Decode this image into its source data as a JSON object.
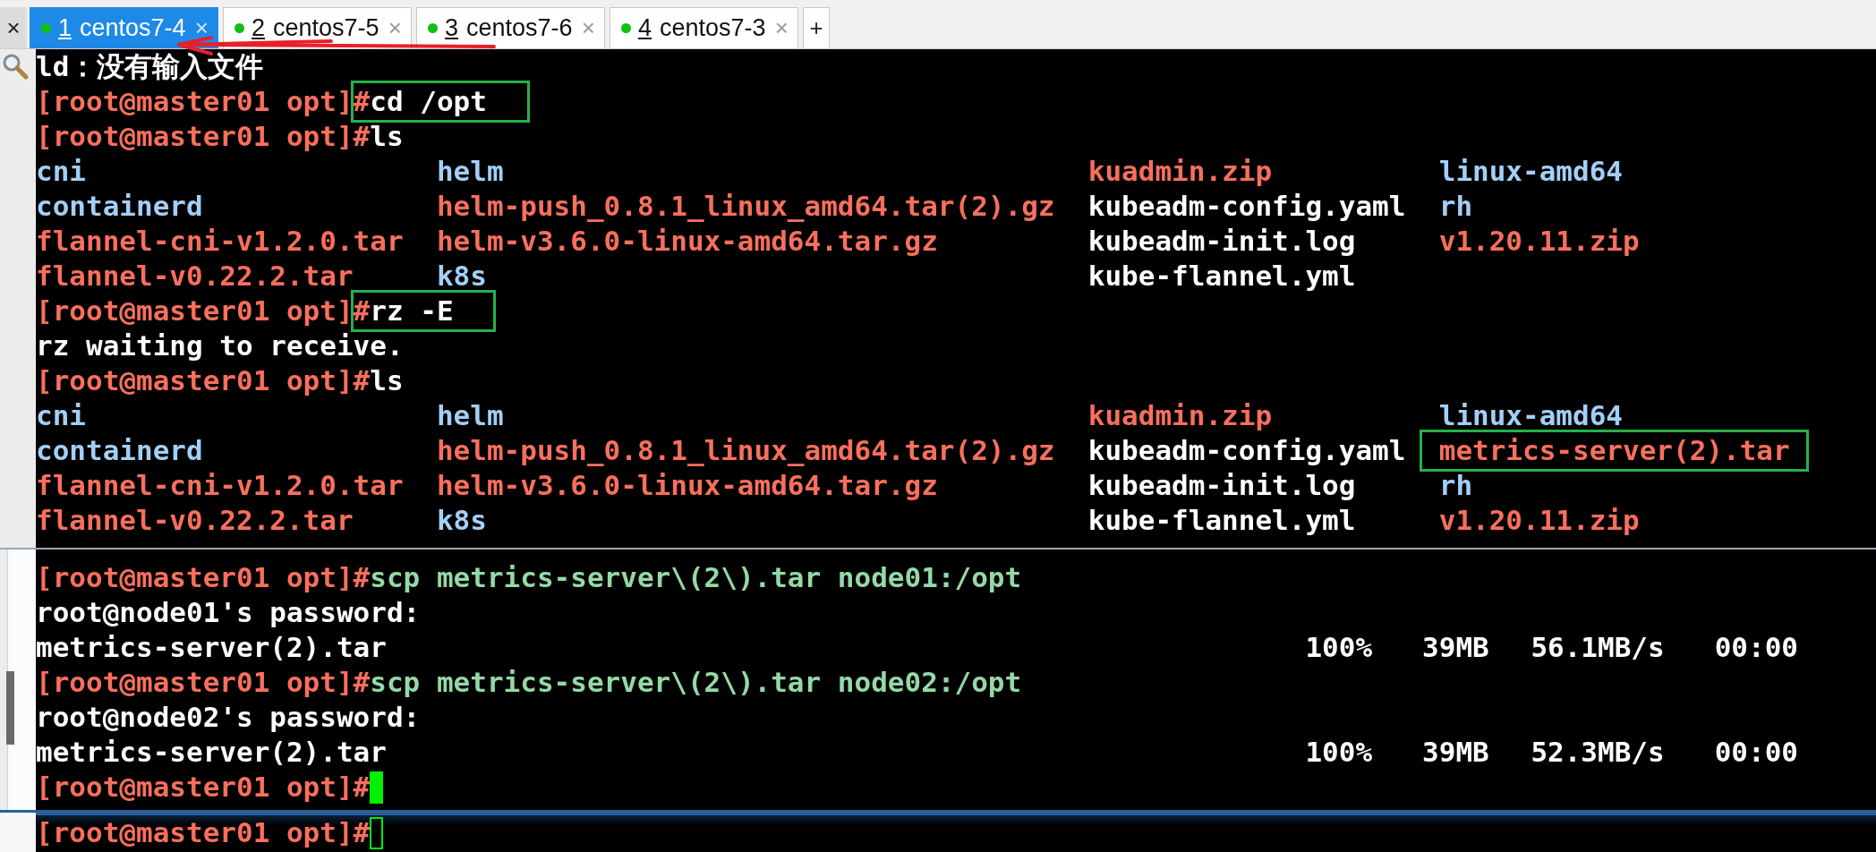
{
  "toolbar": {
    "close": "×"
  },
  "tabs": [
    {
      "number": "1",
      "label": "centos7-4",
      "close": "×",
      "selected": true
    },
    {
      "number": "2",
      "label": "centos7-5",
      "close": "×",
      "selected": false
    },
    {
      "number": "3",
      "label": "centos7-6",
      "close": "×",
      "selected": false
    },
    {
      "number": "4",
      "label": "centos7-3",
      "close": "×",
      "selected": false
    }
  ],
  "new_tab": "+",
  "panels": [
    {
      "kind": "main",
      "lines": [
        {
          "kind": "output",
          "text": "ld：没有输入文件"
        },
        {
          "kind": "prompt",
          "prompt": "[root@master01 opt]",
          "sign": "#",
          "command": "cd /opt",
          "highlighted": true
        },
        {
          "kind": "prompt",
          "prompt": "[root@master01 opt]",
          "sign": "#",
          "command": "ls",
          "highlighted": false
        },
        {
          "kind": "listing",
          "entries": [
            {
              "text": "cni",
              "kind": "dir",
              "highlighted": false
            },
            {
              "text": "helm",
              "kind": "dir",
              "highlighted": false
            },
            {
              "text": "kuadmin.zip",
              "kind": "archive",
              "highlighted": false
            },
            {
              "text": "linux-amd64",
              "kind": "dir",
              "highlighted": false
            }
          ]
        },
        {
          "kind": "listing",
          "entries": [
            {
              "text": "containerd",
              "kind": "dir",
              "highlighted": false
            },
            {
              "text": "helm-push_0.8.1_linux_amd64.tar(2).gz",
              "kind": "archive",
              "highlighted": false
            },
            {
              "text": "kubeadm-config.yaml",
              "kind": "file",
              "highlighted": false
            },
            {
              "text": "rh",
              "kind": "dir",
              "highlighted": false
            }
          ]
        },
        {
          "kind": "listing",
          "entries": [
            {
              "text": "flannel-cni-v1.2.0.tar",
              "kind": "archive",
              "highlighted": false
            },
            {
              "text": "helm-v3.6.0-linux-amd64.tar.gz",
              "kind": "archive",
              "highlighted": false
            },
            {
              "text": "kubeadm-init.log",
              "kind": "file",
              "highlighted": false
            },
            {
              "text": "v1.20.11.zip",
              "kind": "archive",
              "highlighted": false
            }
          ]
        },
        {
          "kind": "listing",
          "entries": [
            {
              "text": "flannel-v0.22.2.tar",
              "kind": "archive",
              "highlighted": false
            },
            {
              "text": "k8s",
              "kind": "dir",
              "highlighted": false
            },
            {
              "text": "kube-flannel.yml",
              "kind": "file",
              "highlighted": false
            }
          ]
        },
        {
          "kind": "prompt",
          "prompt": "[root@master01 opt]",
          "sign": "#",
          "command": "rz -E",
          "highlighted": true
        },
        {
          "kind": "output",
          "text": "rz waiting to receive."
        },
        {
          "kind": "prompt",
          "prompt": "[root@master01 opt]",
          "sign": "#",
          "command": "ls",
          "highlighted": false
        },
        {
          "kind": "listing",
          "entries": [
            {
              "text": "cni",
              "kind": "dir",
              "highlighted": false
            },
            {
              "text": "helm",
              "kind": "dir",
              "highlighted": false
            },
            {
              "text": "kuadmin.zip",
              "kind": "archive",
              "highlighted": false
            },
            {
              "text": "linux-amd64",
              "kind": "dir",
              "highlighted": false
            }
          ]
        },
        {
          "kind": "listing",
          "entries": [
            {
              "text": "containerd",
              "kind": "dir",
              "highlighted": false
            },
            {
              "text": "helm-push_0.8.1_linux_amd64.tar(2).gz",
              "kind": "archive",
              "highlighted": false
            },
            {
              "text": "kubeadm-config.yaml",
              "kind": "file",
              "highlighted": false
            },
            {
              "text": "metrics-server(2).tar",
              "kind": "archive",
              "highlighted": true
            }
          ]
        },
        {
          "kind": "listing",
          "entries": [
            {
              "text": "flannel-cni-v1.2.0.tar",
              "kind": "archive",
              "highlighted": false
            },
            {
              "text": "helm-v3.6.0-linux-amd64.tar.gz",
              "kind": "archive",
              "highlighted": false
            },
            {
              "text": "kubeadm-init.log",
              "kind": "file",
              "highlighted": false
            },
            {
              "text": "rh",
              "kind": "dir",
              "highlighted": false
            }
          ]
        },
        {
          "kind": "listing",
          "entries": [
            {
              "text": "flannel-v0.22.2.tar",
              "kind": "archive",
              "highlighted": false
            },
            {
              "text": "k8s",
              "kind": "dir",
              "highlighted": false
            },
            {
              "text": "kube-flannel.yml",
              "kind": "file",
              "highlighted": false
            },
            {
              "text": "v1.20.11.zip",
              "kind": "archive",
              "highlighted": false
            }
          ]
        }
      ]
    },
    {
      "kind": "popup",
      "lines": [
        {
          "kind": "prompt",
          "prompt": "[root@master01 opt]",
          "sign": "#",
          "command": "scp metrics-server\\(2\\).tar node01:/opt",
          "highlighted": false
        },
        {
          "kind": "output",
          "text": "root@node01's password:"
        },
        {
          "kind": "transfer",
          "file": "metrics-server(2).tar",
          "percent": "100%",
          "size": "39MB",
          "rate": "56.1MB/s",
          "time": "00:00"
        },
        {
          "kind": "prompt",
          "prompt": "[root@master01 opt]",
          "sign": "#",
          "command": "scp metrics-server\\(2\\).tar node02:/opt",
          "highlighted": false
        },
        {
          "kind": "output",
          "text": "root@node02's password:"
        },
        {
          "kind": "transfer",
          "file": "metrics-server(2).tar",
          "percent": "100%",
          "size": "39MB",
          "rate": "52.3MB/s",
          "time": "00:00"
        },
        {
          "kind": "prompt",
          "prompt": "[root@master01 opt]",
          "sign": "#",
          "cursor": {
            "kind": "filled"
          },
          "highlighted": false
        }
      ]
    },
    {
      "kind": "strip",
      "lines": [
        {
          "kind": "prompt",
          "prompt": "[root@master01 opt]",
          "sign": "#",
          "cursor": {
            "kind": "hollow"
          },
          "highlighted": false
        }
      ]
    }
  ]
}
